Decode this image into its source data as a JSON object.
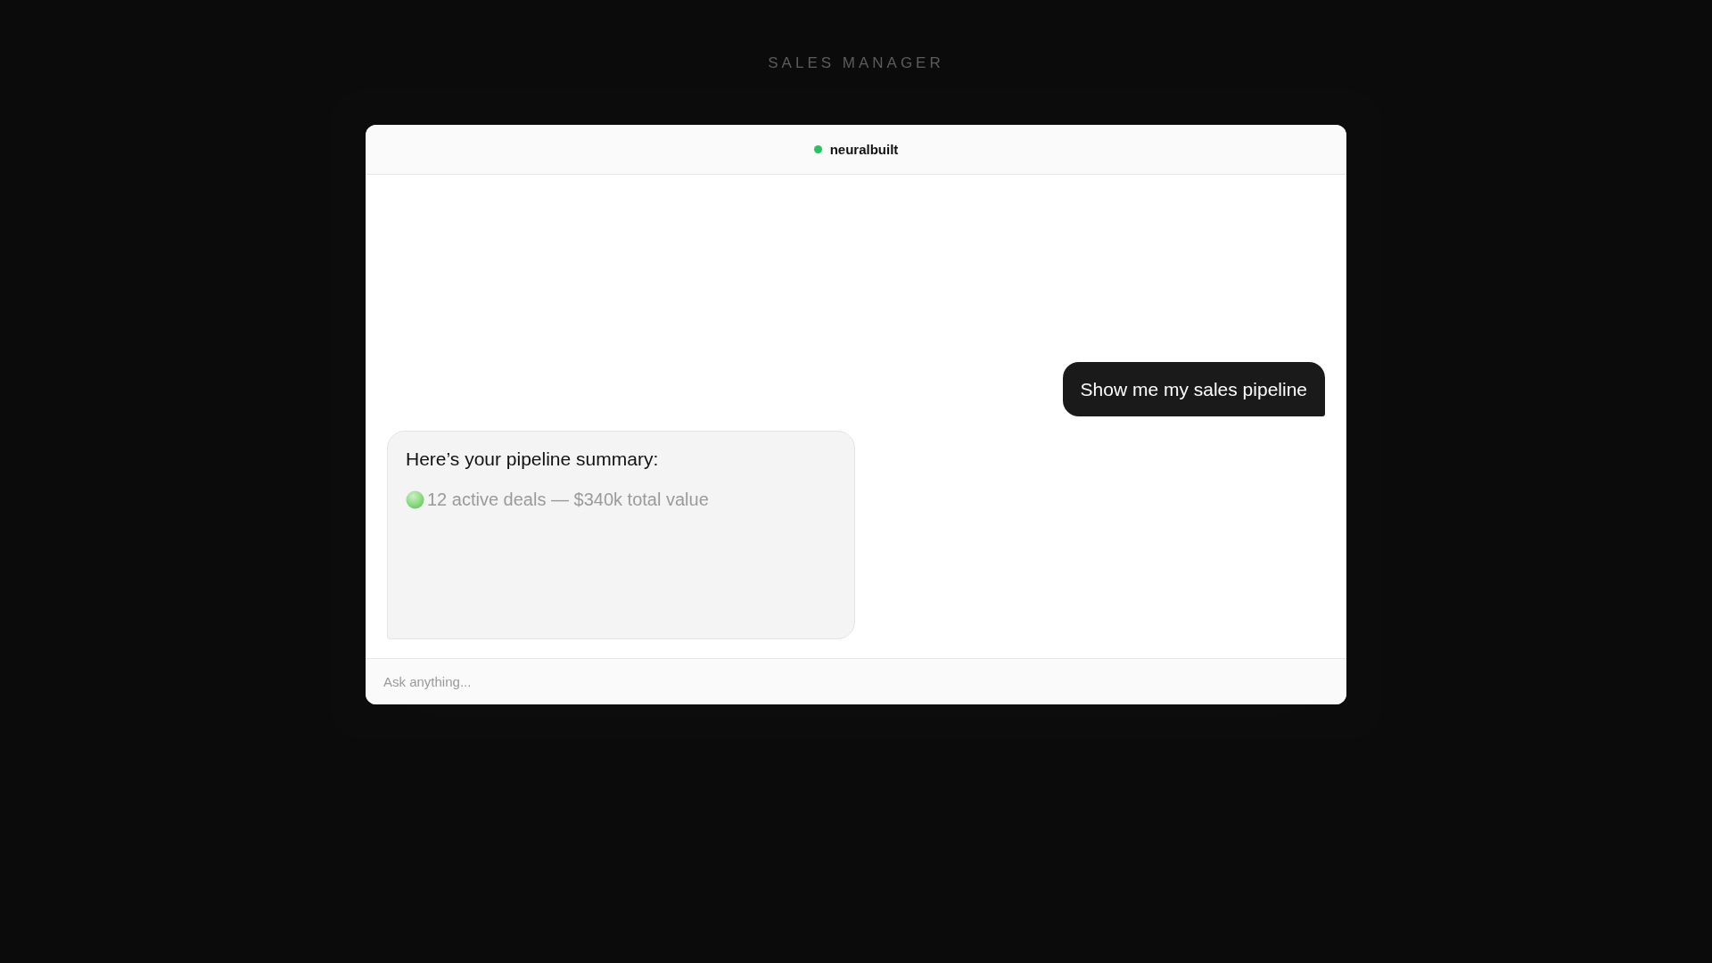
{
  "page": {
    "title": "SALES MANAGER"
  },
  "chat": {
    "header": {
      "name": "neuralbuilt",
      "online": true
    },
    "messages": [
      {
        "kind": "user",
        "text": "Show me my sales pipeline"
      },
      {
        "kind": "assistant",
        "title": "Here’s your pipeline summary:",
        "lines": [
          {
            "kind": "status",
            "text": "12 active deals — $340k total value"
          }
        ]
      }
    ],
    "input": {
      "placeholder": "Ask anything..."
    }
  }
}
